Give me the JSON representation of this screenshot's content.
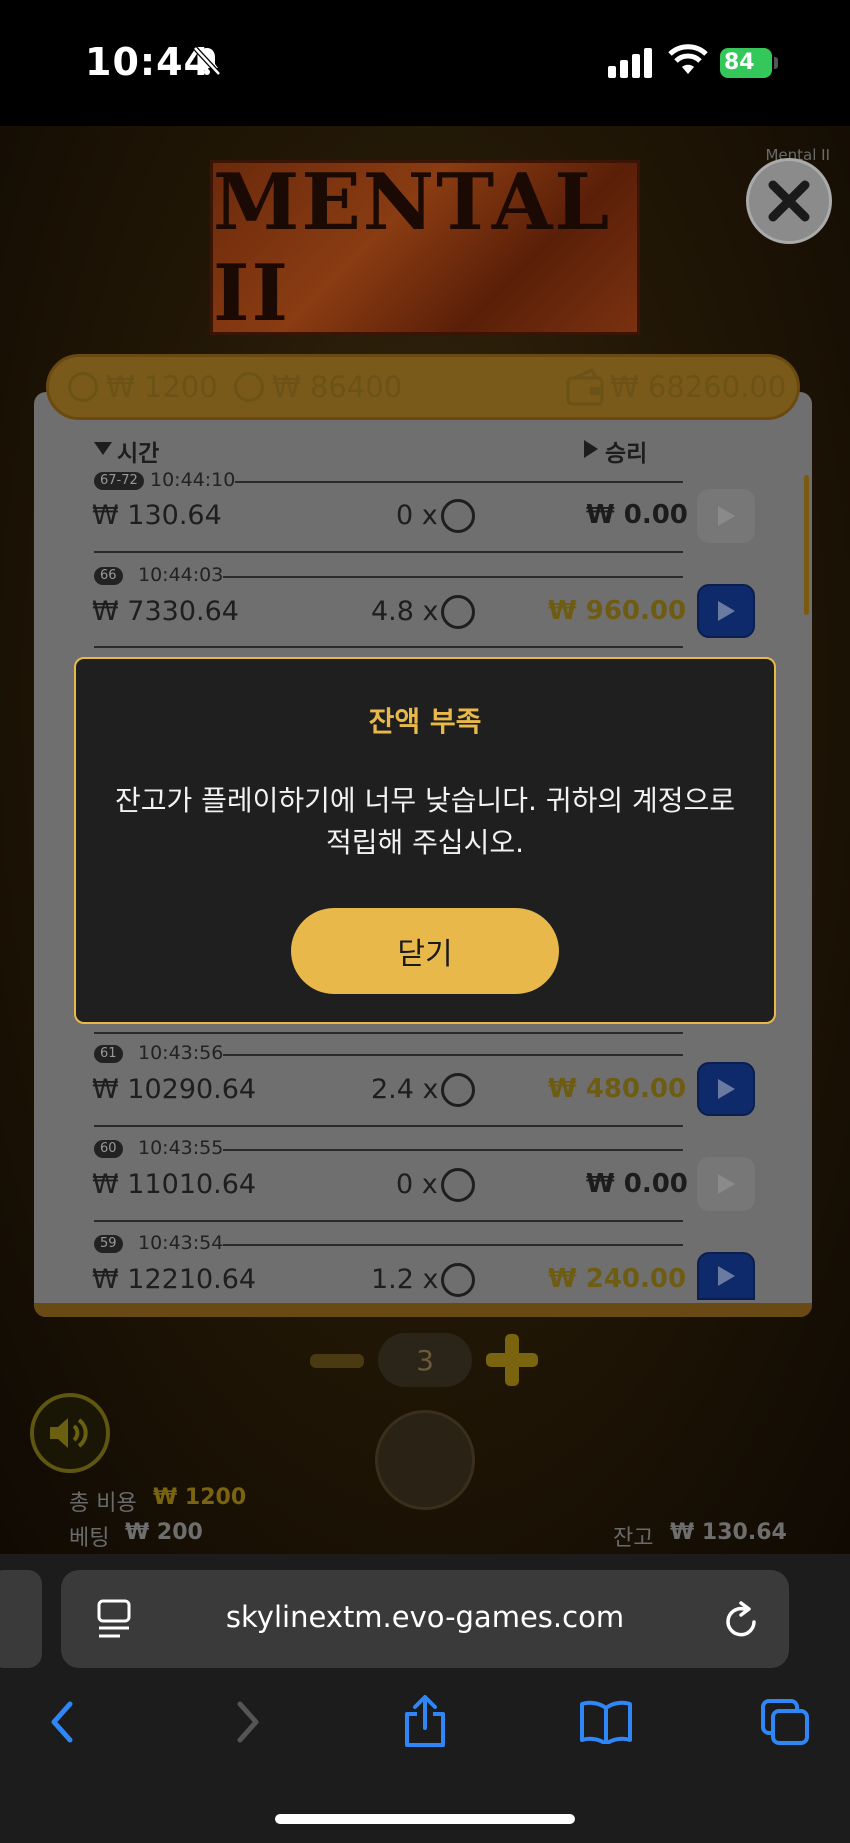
{
  "status_bar": {
    "time": "10:44",
    "battery": "84"
  },
  "game": {
    "tag": "Mental II",
    "logo": "MENTAL II",
    "topbar": {
      "bet_total": "₩ 1200",
      "win_total": "₩ 86400",
      "balance": "₩ 68260.00"
    },
    "history_headers": {
      "time": "시간",
      "win": "승리"
    },
    "rows_top": [
      {
        "badge": "67-72",
        "time": "10:44:10",
        "amount": "₩ 130.64",
        "mult": "0 x",
        "win": "₩ 0.00",
        "win_color": "#1c1c1c",
        "play_active": false
      },
      {
        "badge": "66",
        "time": "10:44:03",
        "amount": "₩ 7330.64",
        "mult": "4.8 x",
        "win": "₩ 960.00",
        "win_color": "#6e5c12",
        "play_active": true
      }
    ],
    "rows_bottom": [
      {
        "badge": "61",
        "time": "10:43:56",
        "amount": "₩ 10290.64",
        "mult": "2.4 x",
        "win": "₩ 480.00",
        "win_color": "#6e5c12",
        "play_active": true
      },
      {
        "badge": "60",
        "time": "10:43:55",
        "amount": "₩ 11010.64",
        "mult": "0 x",
        "win": "₩ 0.00",
        "win_color": "#1c1c1c",
        "play_active": false
      },
      {
        "badge": "59",
        "time": "10:43:54",
        "amount": "₩ 12210.64",
        "mult": "1.2 x",
        "win": "₩ 240.00",
        "win_color": "#6e5c12",
        "play_active": true
      }
    ],
    "stepper_value": "3",
    "total_cost_label": "총 비용",
    "total_cost_value": "₩ 1200",
    "bet_label": "베팅",
    "bet_value": "₩ 200",
    "balance_label": "잔고",
    "balance_value": "₩ 130.64"
  },
  "modal": {
    "title": "잔액 부족",
    "message": "잔고가 플레이하기에 너무 낮습니다. 귀하의 계정으로 적립해 주십시오.",
    "button": "닫기"
  },
  "browser": {
    "url": "skylinextm.evo-games.com"
  },
  "colors": {
    "accent": "#e8b94a",
    "play_blue": "#1f4fd0"
  }
}
